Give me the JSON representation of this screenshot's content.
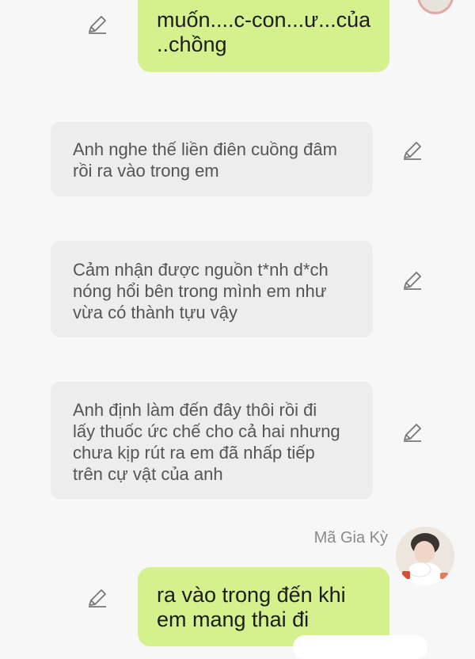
{
  "messages": [
    {
      "side": "right",
      "lines": [
        "muốn....c-con...ư...của",
        "..chồng"
      ]
    },
    {
      "side": "left",
      "lines": [
        "Anh nghe thế liền điên cuồng đâm",
        "rồi ra vào trong em"
      ]
    },
    {
      "side": "left",
      "lines": [
        "Cảm nhận được nguồn t*nh d*ch",
        "nóng hổi bên trong mình em như",
        "vừa có thành tựu vậy"
      ]
    },
    {
      "side": "left",
      "lines": [
        "Anh định làm đến đây thôi rồi đi",
        "lấy thuốc ức chế cho cả hai nhưng",
        "chưa kịp rút ra em đã nhấp tiếp",
        "trên cự vật của anh"
      ]
    },
    {
      "side": "right",
      "sender": "Mã Gia Kỳ",
      "lines": [
        "ra vào trong đến khi",
        "em mang thai đi"
      ]
    }
  ],
  "icons": {
    "edit": "pencil-icon",
    "avatar": "avatar-image"
  },
  "colors": {
    "right_bubble": "#d4f18e",
    "left_bubble": "#ededed",
    "background": "#f7f7f7"
  }
}
